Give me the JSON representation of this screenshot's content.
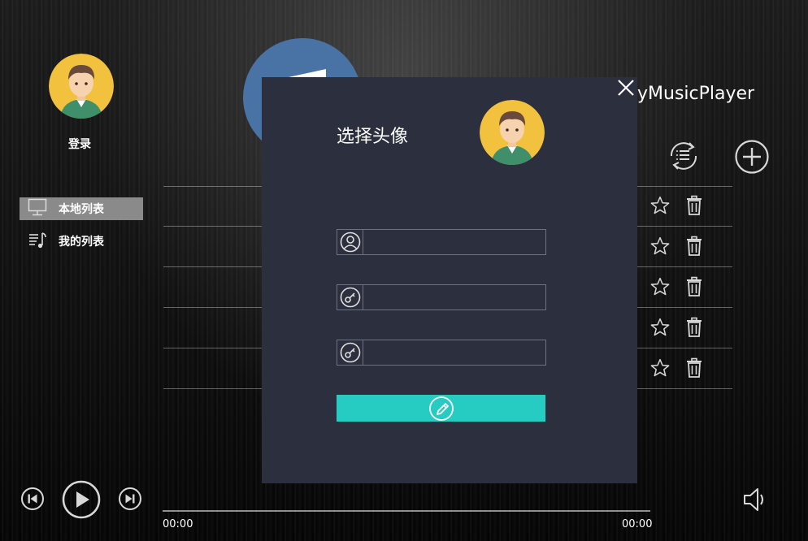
{
  "app": {
    "title": "yMusicPlayer"
  },
  "user": {
    "login_label": "登录"
  },
  "sidebar": {
    "items": [
      {
        "label": "本地列表",
        "icon": "monitor-icon",
        "active": true
      },
      {
        "label": "我的列表",
        "icon": "playlist-icon",
        "active": false
      }
    ]
  },
  "toolbar": {
    "loop_icon": "loop-list-icon",
    "add_icon": "add-icon"
  },
  "song_rows": [
    {
      "fav_icon": "star-icon",
      "delete_icon": "trash-icon"
    },
    {
      "fav_icon": "star-icon",
      "delete_icon": "trash-icon"
    },
    {
      "fav_icon": "star-icon",
      "delete_icon": "trash-icon"
    },
    {
      "fav_icon": "star-icon",
      "delete_icon": "trash-icon"
    },
    {
      "fav_icon": "star-icon",
      "delete_icon": "trash-icon"
    }
  ],
  "player": {
    "current_time": "00:00",
    "total_time": "00:00",
    "progress": 0
  },
  "modal": {
    "title": "选择头像",
    "username": {
      "value": "",
      "placeholder": ""
    },
    "password": {
      "value": "",
      "placeholder": ""
    },
    "confirm_password": {
      "value": "",
      "placeholder": ""
    },
    "submit_icon": "edit-icon",
    "accent": "#26cbc2",
    "background": "#2b2f3e"
  }
}
